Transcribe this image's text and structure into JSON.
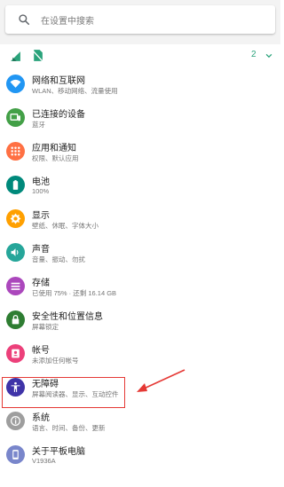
{
  "search": {
    "placeholder": "在设置中搜索"
  },
  "conditions": {
    "count": "2"
  },
  "items": [
    {
      "title": "网络和互联网",
      "subtitle": "WLAN、移动网络、流量使用",
      "icon": "wifi-icon",
      "color": "#2196f3"
    },
    {
      "title": "已连接的设备",
      "subtitle": "蓝牙",
      "icon": "devices-icon",
      "color": "#43a047"
    },
    {
      "title": "应用和通知",
      "subtitle": "权限、默认应用",
      "icon": "apps-icon",
      "color": "#ff7043"
    },
    {
      "title": "电池",
      "subtitle": "100%",
      "icon": "battery-icon",
      "color": "#00897b"
    },
    {
      "title": "显示",
      "subtitle": "壁纸、休眠、字体大小",
      "icon": "brightness-icon",
      "color": "#ffa000"
    },
    {
      "title": "声音",
      "subtitle": "音量、振动、勿扰",
      "icon": "volume-icon",
      "color": "#26a69a"
    },
    {
      "title": "存储",
      "subtitle": "已使用 75% · 还剩 16.14 GB",
      "icon": "storage-icon",
      "color": "#ab47bc"
    },
    {
      "title": "安全性和位置信息",
      "subtitle": "屏幕锁定",
      "icon": "lock-icon",
      "color": "#2e7d32"
    },
    {
      "title": "帐号",
      "subtitle": "未添加任何帐号",
      "icon": "account-icon",
      "color": "#ec407a"
    },
    {
      "title": "无障碍",
      "subtitle": "屏幕阅读器、显示、互动控件",
      "icon": "accessibility-icon",
      "color": "#3f33a8"
    },
    {
      "title": "系统",
      "subtitle": "语言、时间、备份、更新",
      "icon": "info-icon",
      "color": "#9e9e9e"
    },
    {
      "title": "关于平板电脑",
      "subtitle": "V1936A",
      "icon": "tablet-icon",
      "color": "#7986cb"
    }
  ],
  "colors": {
    "accent": "#2aa37b",
    "highlight": "#e53935"
  }
}
